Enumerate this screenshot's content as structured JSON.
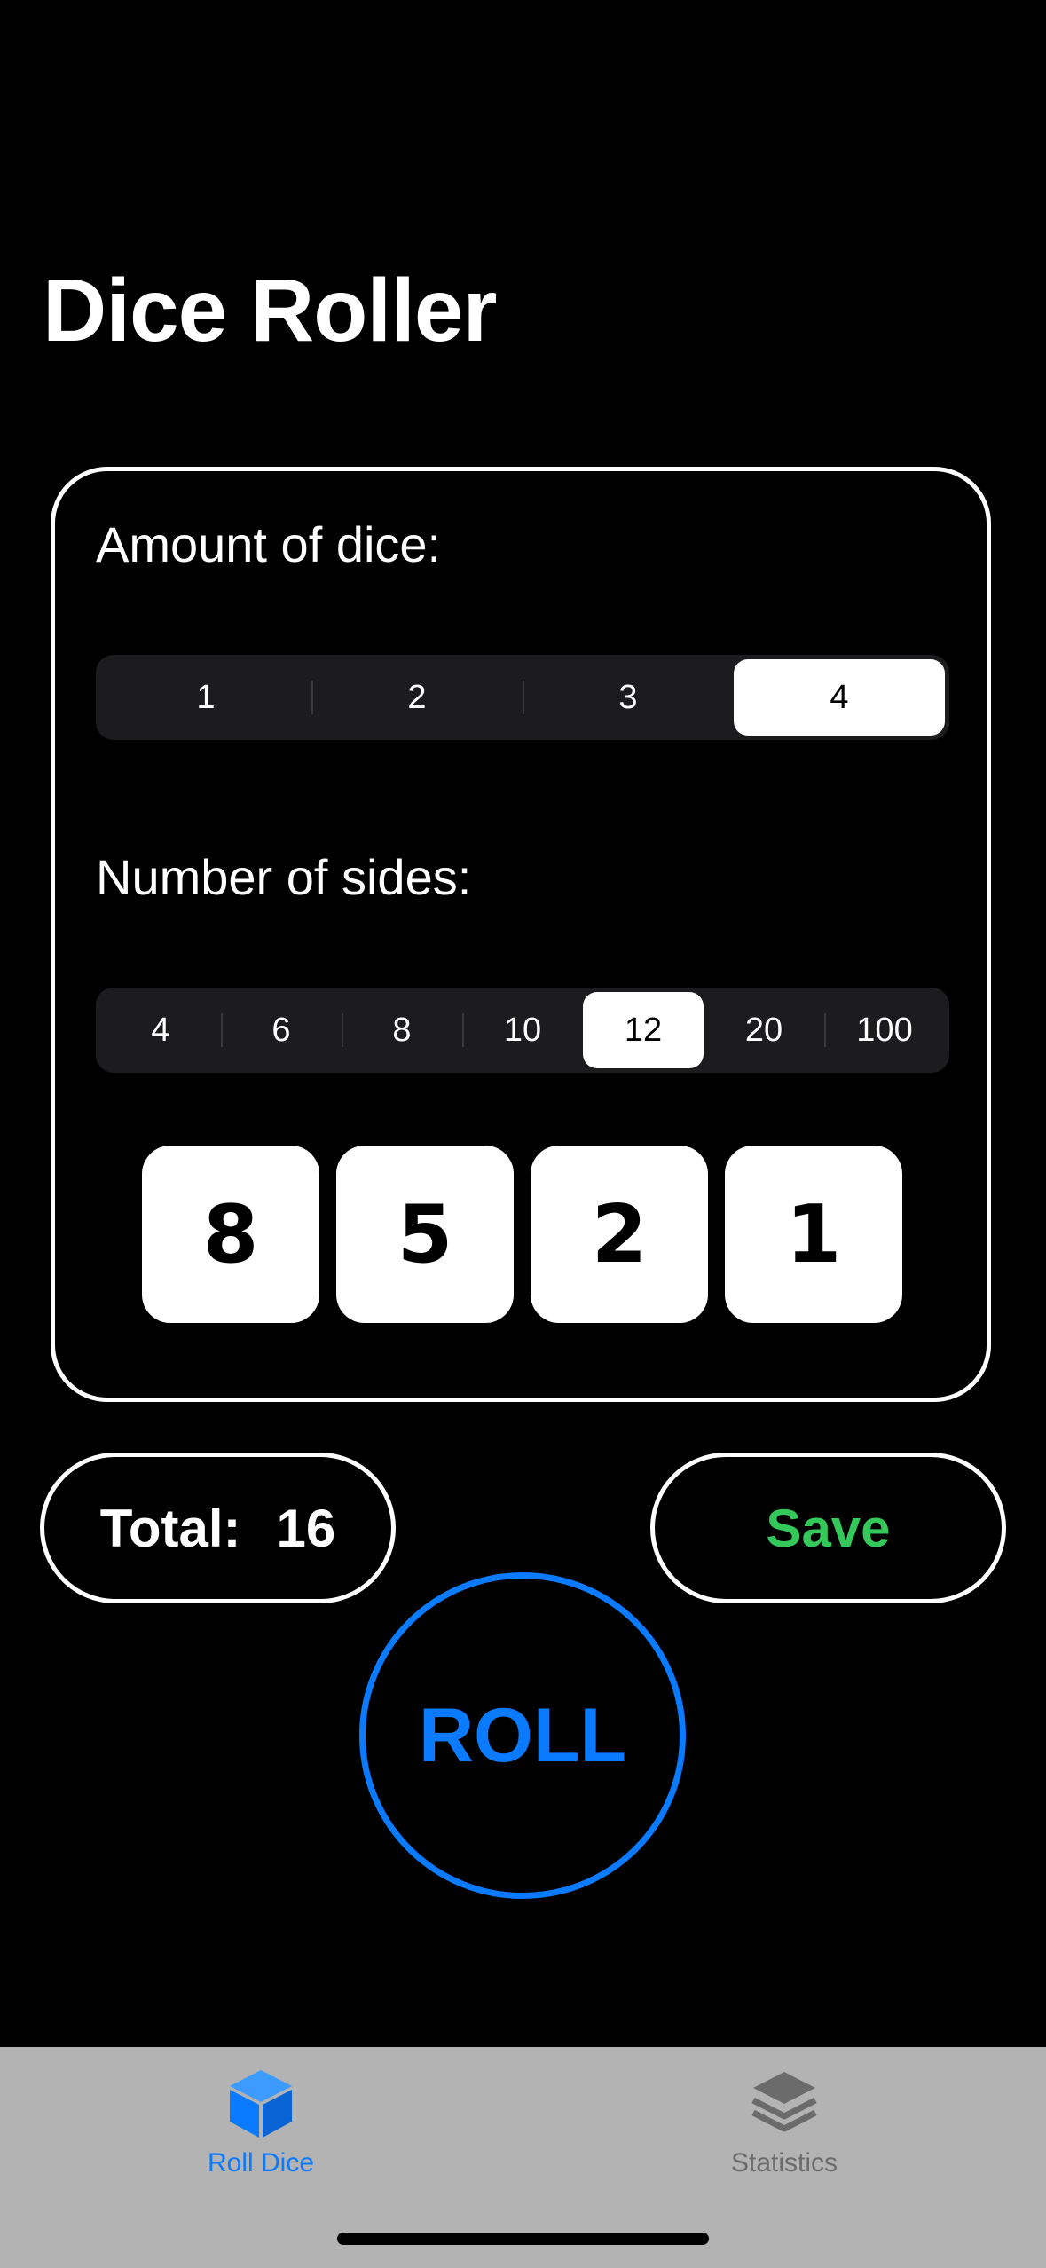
{
  "header": {
    "title": "Dice Roller"
  },
  "dice_settings": {
    "amount_label": "Amount of dice:",
    "amount_options": [
      "1",
      "2",
      "3",
      "4"
    ],
    "amount_selected": "4",
    "sides_label": "Number of sides:",
    "sides_options": [
      "4",
      "6",
      "8",
      "10",
      "12",
      "20",
      "100"
    ],
    "sides_selected": "12",
    "results": [
      "8",
      "5",
      "2",
      "1"
    ]
  },
  "summary": {
    "total_label": "Total:",
    "total_value": "16",
    "save_label": "Save"
  },
  "roll": {
    "label": "ROLL"
  },
  "tab_bar": {
    "tabs": [
      {
        "label": "Roll Dice",
        "icon": "cube-icon",
        "active": true
      },
      {
        "label": "Statistics",
        "icon": "stack-icon",
        "active": false
      }
    ]
  },
  "colors": {
    "accent": "#0a7aff",
    "save": "#34c759",
    "background": "#000000",
    "tab_bar": "#b3b3b3"
  }
}
